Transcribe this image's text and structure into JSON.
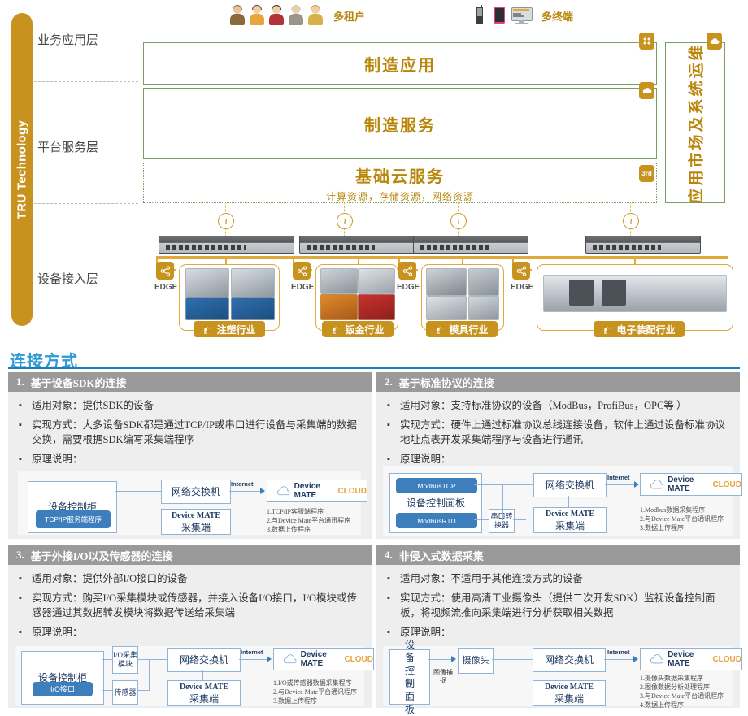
{
  "sidebar": {
    "label": "TRU Technology"
  },
  "arch": {
    "layers": [
      {
        "name": "业务应用层"
      },
      {
        "name": "平台服务层"
      },
      {
        "name": "设备接入层"
      }
    ],
    "multi_tenant": {
      "label": "多租户",
      "icon": "users-icon",
      "count": 5
    },
    "multi_terminal": {
      "label": "多终端",
      "icons": [
        "phone-icon",
        "tablet-icon",
        "monitor-icon"
      ]
    },
    "boxes": [
      {
        "title": "制造应用",
        "subtitle": "",
        "badge": "apps-grid-icon",
        "style": "solid"
      },
      {
        "title": "制造服务",
        "subtitle": "",
        "badge": "cloud-icon",
        "style": "solid"
      },
      {
        "title": "基础云服务",
        "subtitle": "计算资源，存储资源，网络资源",
        "badge": "3rd",
        "style": "dotted"
      }
    ],
    "right_panel": {
      "title": "应用市场及系统运维",
      "badge": "cloud-icon"
    },
    "edge_label": "EDGE",
    "industries": [
      {
        "name": "注塑行业",
        "icon": "robot-arm-icon"
      },
      {
        "name": "钣金行业",
        "icon": "robot-arm-icon"
      },
      {
        "name": "模具行业",
        "icon": "robot-arm-icon"
      },
      {
        "name": "电子装配行业",
        "icon": "robot-arm-icon"
      }
    ]
  },
  "connection_section": {
    "title": "连接方式",
    "quadrants": [
      {
        "num": "1.",
        "heading": "基于设备SDK的连接",
        "bullets": [
          "适用对象：提供SDK的设备",
          "实现方式：大多设备SDK都是通过TCP/IP或串口进行设备与采集端的数据交换，需要根据SDK编写采集端程序",
          "原理说明："
        ],
        "diagram": {
          "device_box": "设备控制柜",
          "device_pill": "TCP/IP服务端程序",
          "switch": "网络交换机",
          "collector": "Device MATE\n采集端",
          "collector_l1": "Device MATE",
          "collector_l2": "采集端",
          "internet": "Internet",
          "cloud_name": "Device MATE",
          "cloud_suffix": "CLOUD",
          "notes": [
            "1.TCP/IP客服端程序",
            "2.与Device Mate平台通讯程序",
            "3.数据上传程序"
          ]
        }
      },
      {
        "num": "2.",
        "heading": "基于标准协议的连接",
        "bullets": [
          "适用对象：支持标准协议的设备（ModBus，ProfiBus，OPC等 ）",
          "实现方式：硬件上通过标准协议总线连接设备，软件上通过设备标准协议地址点表开发采集端程序与设备进行通讯",
          "原理说明："
        ],
        "diagram": {
          "device_box": "设备控制面板",
          "pill_top": "ModbusTCP",
          "pill_bottom": "ModbusRTU",
          "converter": "串口转换器",
          "switch": "网络交换机",
          "collector_l1": "Device MATE",
          "collector_l2": "采集端",
          "internet": "Internet",
          "cloud_name": "Device MATE",
          "cloud_suffix": "CLOUD",
          "notes": [
            "1.Modbus数据采集程序",
            "2.与Device Mate平台通讯程序",
            "3.数据上传程序"
          ]
        }
      },
      {
        "num": "3.",
        "heading": "基于外接I/O以及传感器的连接",
        "bullets": [
          "适用对象：提供外部I/O接口的设备",
          "实现方式：购买I/O采集模块或传感器，并接入设备I/O接口，I/O模块或传感器通过其数据转发模块将数据传送给采集端",
          "原理说明："
        ],
        "diagram": {
          "device_box": "设备控制柜",
          "device_pill": "I/O接口",
          "io_module": "I/O采集模块",
          "sensor": "传感器",
          "switch": "网络交换机",
          "collector_l1": "Device MATE",
          "collector_l2": "采集端",
          "internet": "Internet",
          "cloud_name": "Device MATE",
          "cloud_suffix": "CLOUD",
          "notes": [
            "1.I/O或传感器数据采集程序",
            "2.与Device Mate平台通讯程序",
            "3.数据上传程序"
          ]
        }
      },
      {
        "num": "4.",
        "heading": "非侵入式数据采集",
        "bullets": [
          "适用对象：不适用于其他连接方式的设备",
          "实现方式：使用高清工业摄像头（提供二次开发SDK）监视设备控制面板，将视频流推向采集端进行分析获取相关数据",
          "原理说明："
        ],
        "diagram": {
          "device_box": "设备控制面板",
          "capture_label": "图像捕捉",
          "camera": "摄像头",
          "switch": "网络交换机",
          "collector_l1": "Device MATE",
          "collector_l2": "采集端",
          "internet": "Internet",
          "cloud_name": "Device MATE",
          "cloud_suffix": "CLOUD",
          "notes": [
            "1.摄像头数据采集程序",
            "2.图像数据分析处理程序",
            "3.与Device Mate平台通讯程序",
            "4.数据上传程序"
          ]
        }
      }
    ]
  },
  "colors": {
    "gold": "#c8921f",
    "green_border": "#7a9e63",
    "blue_title": "#2e9bd6",
    "grey_head": "#9a9a9a",
    "panel_bg": "#eeeeee",
    "node_blue": "#3d7ebd"
  }
}
